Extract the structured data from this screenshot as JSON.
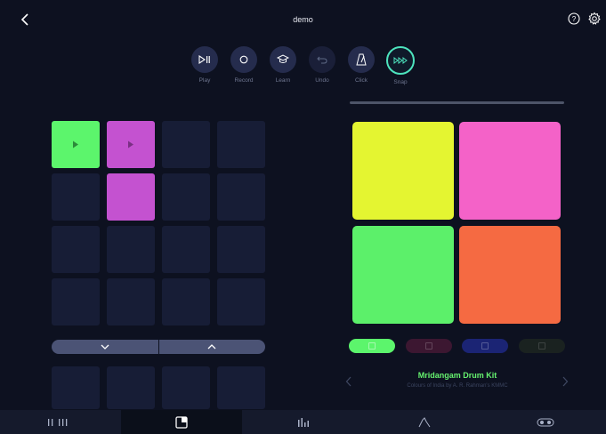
{
  "header": {
    "title": "demo",
    "back_icon": "chevron-left-icon",
    "help_icon": "help-circle-icon",
    "settings_icon": "gear-icon"
  },
  "controls": [
    {
      "label": "Play",
      "icon": "play-pause-icon"
    },
    {
      "label": "Record",
      "icon": "record-icon"
    },
    {
      "label": "Learn",
      "icon": "graduation-cap-icon"
    },
    {
      "label": "Undo",
      "icon": "undo-icon"
    },
    {
      "label": "Click",
      "icon": "metronome-icon"
    },
    {
      "label": "Snap",
      "icon": "snap-icon"
    }
  ],
  "colors": {
    "background": "#0d1120",
    "empty_cell": "#171d36",
    "loop_green": "#5cf56c",
    "loop_magenta": "#c452d0",
    "pad_yellow": "#e4f531",
    "pad_pink": "#f462c8",
    "pad_green": "#5cf06a",
    "pad_orange": "#f56a42",
    "snap_accent": "#4de3bd",
    "kit_name": "#66f26f"
  },
  "kit": {
    "name": "Mridangam Drum Kit",
    "subtitle": "Colours of India by A. R. Rahman's KMMC"
  },
  "tabs": [
    {
      "name": "tab-sequencer",
      "icon": "bars-icon"
    },
    {
      "name": "tab-pads",
      "icon": "pads-icon"
    },
    {
      "name": "tab-mixer",
      "icon": "mixer-icon"
    },
    {
      "name": "tab-effects",
      "icon": "envelope-icon"
    },
    {
      "name": "tab-settings",
      "icon": "toggle-icon"
    }
  ]
}
